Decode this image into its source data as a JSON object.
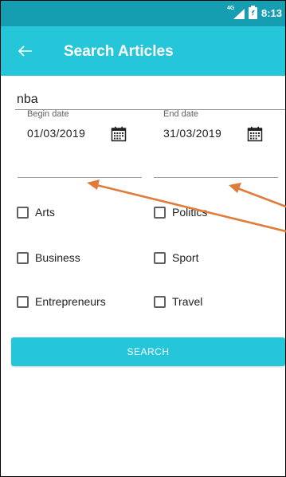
{
  "status_bar": {
    "network": "4G",
    "time": "8:13"
  },
  "app_bar": {
    "back_icon": "arrow-left-icon",
    "title": "Search Articles"
  },
  "search": {
    "query": "nba"
  },
  "dates": {
    "begin": {
      "label": "Begin date",
      "value": "01/03/2019",
      "icon": "calendar-icon"
    },
    "end": {
      "label": "End date",
      "value": "31/03/2019",
      "icon": "calendar-icon"
    }
  },
  "categories": [
    {
      "label": "Arts",
      "checked": false
    },
    {
      "label": "Politics",
      "checked": false
    },
    {
      "label": "Business",
      "checked": false
    },
    {
      "label": "Sport",
      "checked": false
    },
    {
      "label": "Entrepreneurs",
      "checked": false
    },
    {
      "label": "Travel",
      "checked": false
    }
  ],
  "search_button": {
    "label": "SEARCH"
  },
  "colors": {
    "status_bar": "#159db1",
    "app_bar": "#26c6da",
    "button": "#26c6da",
    "annotation_arrow": "#e07b39"
  }
}
